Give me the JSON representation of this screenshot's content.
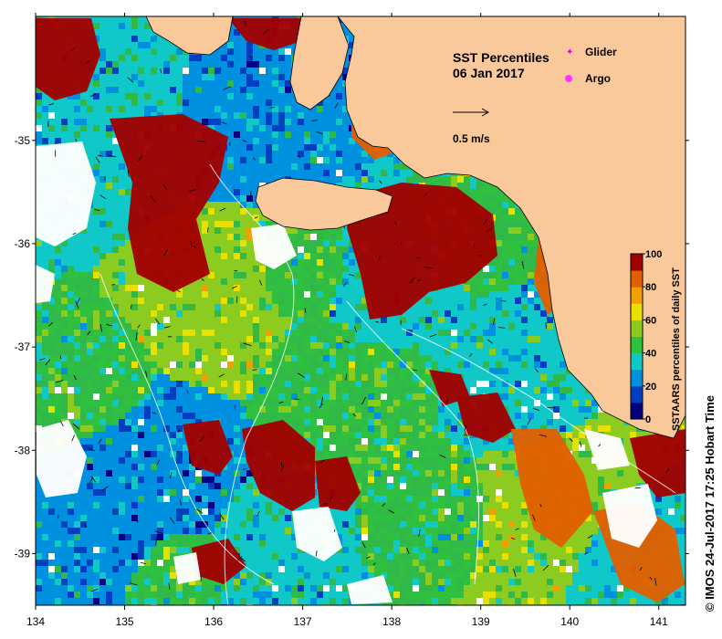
{
  "title": {
    "line1": "SST Percentiles",
    "line2": "06 Jan 2017"
  },
  "legend": {
    "glider_label": "Glider",
    "argo_label": "Argo",
    "glider_color": "#e000e0",
    "argo_color": "#ff33ff",
    "scale_value": "0.5 m/s"
  },
  "colorbar": {
    "title": "SSTAARS percentiles of daily  SST",
    "ticks": [
      "0",
      "20",
      "40",
      "60",
      "80",
      "100"
    ],
    "colors": [
      "#000080",
      "#0040c0",
      "#0090e0",
      "#10c8c8",
      "#30c040",
      "#8ccc20",
      "#e8e000",
      "#f0a000",
      "#e06000",
      "#a00000"
    ]
  },
  "credit": "©  IMOS 24-Jul-2017 17:25 Hobart Time",
  "map": {
    "land_color": "#f9c99b",
    "no_data_color": "#ffffff",
    "x_range": [
      134,
      141.3
    ],
    "y_range": [
      -39.5,
      -33.8
    ],
    "x_ticks": [
      "134",
      "135",
      "136",
      "137",
      "138",
      "139",
      "140",
      "141"
    ],
    "y_ticks": [
      "-35",
      "-36",
      "-37",
      "-38",
      "-39"
    ]
  }
}
